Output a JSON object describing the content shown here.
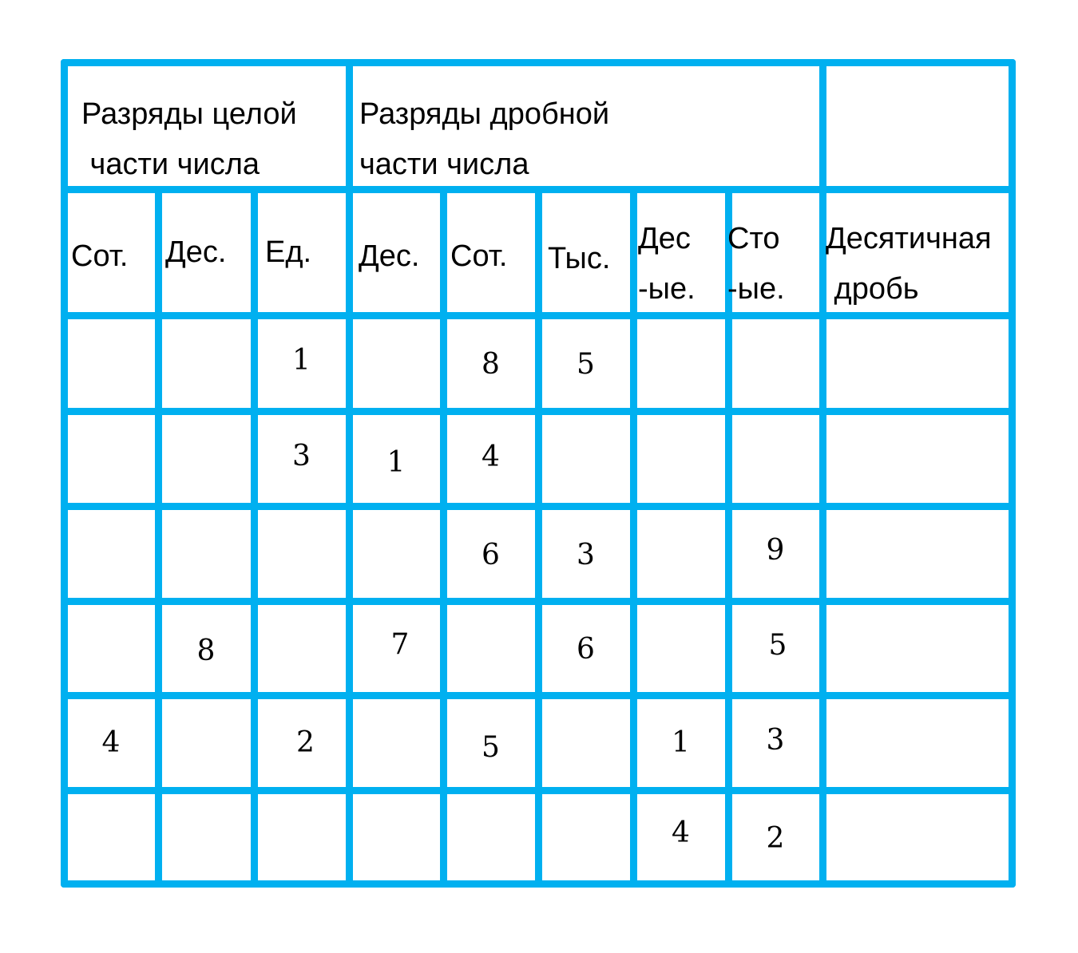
{
  "header": {
    "integer_group": [
      "Разряды целой",
      " части числа"
    ],
    "fraction_group": [
      "Разряды дробной",
      "части числа"
    ],
    "empty_group": ""
  },
  "columns": [
    [
      "Сот."
    ],
    [
      "Дес."
    ],
    [
      "Ед."
    ],
    [
      "Дес."
    ],
    [
      "Сот."
    ],
    [
      "Тыс."
    ],
    [
      "Дес",
      "-ые."
    ],
    [
      "Сто",
      "-ые."
    ],
    [
      "Десятичная",
      " дробь"
    ]
  ],
  "rows": [
    [
      "",
      "",
      "1",
      "",
      "8",
      "5",
      "",
      "",
      ""
    ],
    [
      "",
      "",
      "3",
      "1",
      "4",
      "",
      "",
      "",
      ""
    ],
    [
      "",
      "",
      "",
      "",
      "6",
      "3",
      "",
      "9",
      ""
    ],
    [
      "",
      "8",
      "",
      "7",
      "",
      "6",
      "",
      "5",
      ""
    ],
    [
      "4",
      "",
      "2",
      "",
      "5",
      "",
      "1",
      "3",
      ""
    ],
    [
      "",
      "",
      "",
      "",
      "",
      "",
      "4",
      "2",
      ""
    ]
  ],
  "colors": {
    "grid_line": "#00B0F0",
    "text": "#000000"
  }
}
